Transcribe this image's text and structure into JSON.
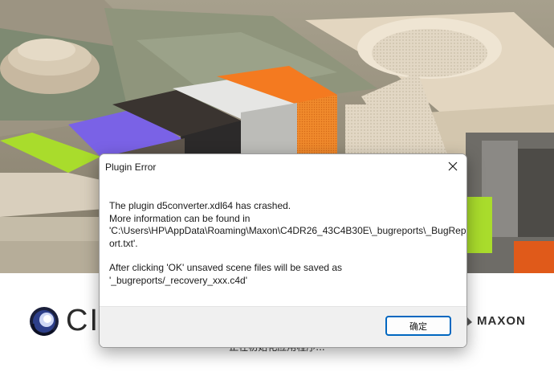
{
  "splash": {
    "brand_partial": "CIN",
    "maxon_label": "MAXON",
    "status_text": "正在初始化应用程序...",
    "colors": {
      "orange": "#f47a20",
      "purple": "#7a62e6",
      "lime": "#a9dc2c",
      "sage": "#8d937b",
      "beige": "#d9cfbd"
    }
  },
  "dialog": {
    "title": "Plugin Error",
    "close_icon": "close-icon",
    "message_lines": [
      "The plugin d5converter.xdl64 has crashed.",
      "More information can be found in",
      "'C:\\Users\\HP\\AppData\\Roaming\\Maxon\\C4DR26_43C4B30E\\_bugreports\\_BugRep",
      "ort.txt'."
    ],
    "message_lines_2": [
      "After clicking 'OK' unsaved scene files will be saved as",
      "'_bugreports/_recovery_xxx.c4d'"
    ],
    "ok_label": "确定",
    "accent": "#0067c0"
  }
}
